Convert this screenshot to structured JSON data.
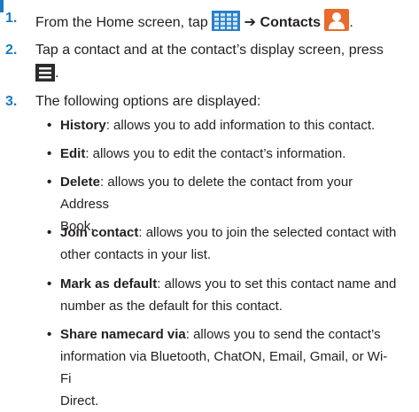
{
  "steps": [
    {
      "number": "1.",
      "text_before": "From the Home screen, tap",
      "arrow": "➔",
      "bold": "Contacts",
      "text_after": "."
    },
    {
      "number": "2.",
      "line1": "Tap a contact and at the contact’s display screen, press",
      "line2_after": "."
    },
    {
      "number": "3.",
      "text": "The following options are displayed:"
    }
  ],
  "options": [
    {
      "term": "History",
      "desc": ": allows you to add information to this contact."
    },
    {
      "term": "Edit",
      "desc": ": allows you to edit the contact’s information."
    },
    {
      "term": "Delete",
      "desc": ": allows you to delete the contact from your Address",
      "desc2": "Book."
    },
    {
      "term": "Join contact",
      "desc": ": allows you to join the selected contact with",
      "desc2": "other contacts in your list."
    },
    {
      "term": "Mark as default",
      "desc": ": allows you to set this contact name and",
      "desc2": "number as the default for this contact."
    },
    {
      "term": "Share namecard via",
      "desc": ": allows you to send the contact’s",
      "desc2": "information via Bluetooth, ChatON, Email, Gmail, or Wi-Fi",
      "desc3": "Direct."
    }
  ],
  "bullet": "•",
  "icons": {
    "apps": "apps-grid-icon",
    "contacts": "contacts-app-icon",
    "menu": "menu-key-icon"
  },
  "colors": {
    "step_number": "#1a7bbf",
    "text": "#231f20",
    "apps_icon": "#2b7fc9",
    "contacts_icon": "#e96a2c"
  }
}
